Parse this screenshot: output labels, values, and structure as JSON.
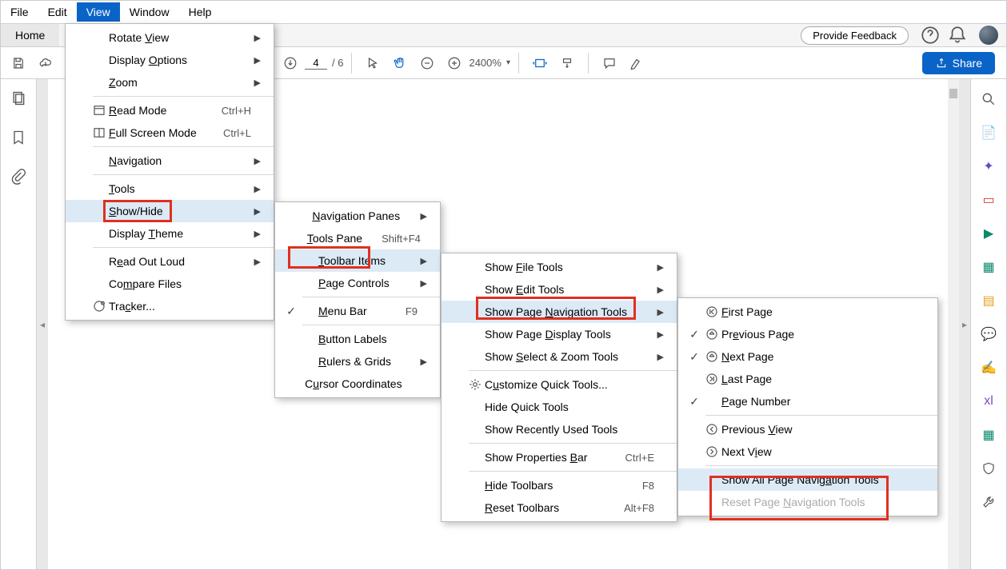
{
  "menubar": [
    "File",
    "Edit",
    "View",
    "Window",
    "Help"
  ],
  "tabs": {
    "home": "Home",
    "feedback": "Provide Feedback"
  },
  "toolbar": {
    "page_current": "4",
    "page_total": "/ 6",
    "zoom": "2400%",
    "share": "Share"
  },
  "view_menu": [
    {
      "label": "Rotate View",
      "u": 7,
      "sub": true
    },
    {
      "label": "Display Options",
      "u": 8,
      "sub": true
    },
    {
      "label": "Zoom",
      "u": 0,
      "sub": true
    },
    {
      "divider": true
    },
    {
      "label": "Read Mode",
      "u": 0,
      "icon": "readmode",
      "accel": "Ctrl+H"
    },
    {
      "label": "Full Screen Mode",
      "u": 0,
      "icon": "fullscreen",
      "accel": "Ctrl+L"
    },
    {
      "divider": true
    },
    {
      "label": "Navigation",
      "u": 0,
      "sub": true
    },
    {
      "divider": true
    },
    {
      "label": "Tools",
      "u": 0,
      "sub": true
    },
    {
      "label": "Show/Hide",
      "u": 0,
      "sub": true,
      "hover": true
    },
    {
      "label": "Display Theme",
      "u": 8,
      "sub": true
    },
    {
      "divider": true
    },
    {
      "label": "Read Out Loud",
      "u": 1,
      "sub": true
    },
    {
      "label": "Compare Files",
      "u": 2
    },
    {
      "label": "Tracker...",
      "u": 3,
      "icon": "tracker"
    }
  ],
  "showhide_menu": [
    {
      "label": "Navigation Panes",
      "u": 0,
      "sub": true
    },
    {
      "label": "Tools Pane",
      "u": 0,
      "accel": "Shift+F4"
    },
    {
      "label": "Toolbar Items",
      "u": 0,
      "sub": true,
      "hover": true
    },
    {
      "label": "Page Controls",
      "u": 0,
      "sub": true
    },
    {
      "divider": true
    },
    {
      "label": "Menu Bar",
      "u": 0,
      "accel": "F9",
      "check": true
    },
    {
      "divider": true
    },
    {
      "label": "Button Labels",
      "u": 0
    },
    {
      "label": "Rulers & Grids",
      "u": 0,
      "sub": true
    },
    {
      "label": "Cursor Coordinates",
      "u": 1
    }
  ],
  "toolbaritems_menu": [
    {
      "label": "Show File Tools",
      "u": 5,
      "sub": true
    },
    {
      "label": "Show Edit Tools",
      "u": 5,
      "sub": true
    },
    {
      "label": "Show Page Navigation Tools",
      "u": 10,
      "sub": true,
      "hover": true
    },
    {
      "label": "Show Page Display Tools",
      "u": 10,
      "sub": true
    },
    {
      "label": "Show Select & Zoom Tools",
      "u": 5,
      "sub": true
    },
    {
      "divider": true
    },
    {
      "label": "Customize Quick Tools...",
      "u": 1,
      "icon": "gear"
    },
    {
      "label": "Hide Quick Tools"
    },
    {
      "label": "Show Recently Used Tools"
    },
    {
      "divider": true
    },
    {
      "label": "Show Properties Bar",
      "u": 16,
      "accel": "Ctrl+E"
    },
    {
      "divider": true
    },
    {
      "label": "Hide Toolbars",
      "u": 0,
      "accel": "F8"
    },
    {
      "label": "Reset Toolbars",
      "u": 0,
      "accel": "Alt+F8"
    }
  ],
  "pagenav_menu": [
    {
      "label": "First Page",
      "u": 0,
      "icon": "first"
    },
    {
      "label": "Previous Page",
      "u": 2,
      "icon": "prev",
      "check": true
    },
    {
      "label": "Next Page",
      "u": 0,
      "icon": "next",
      "check": true
    },
    {
      "label": "Last Page",
      "u": 0,
      "icon": "last"
    },
    {
      "label": "Page Number",
      "u": 0,
      "check": true
    },
    {
      "divider": true
    },
    {
      "label": "Previous View",
      "u": 9,
      "icon": "pview"
    },
    {
      "label": "Next View",
      "u": 6,
      "icon": "nview"
    },
    {
      "divider": true
    },
    {
      "label": "Show All Page Navigation Tools",
      "u": 19,
      "hover": true
    },
    {
      "label": "Reset Page Navigation Tools",
      "u": 11,
      "disabled": true
    }
  ]
}
